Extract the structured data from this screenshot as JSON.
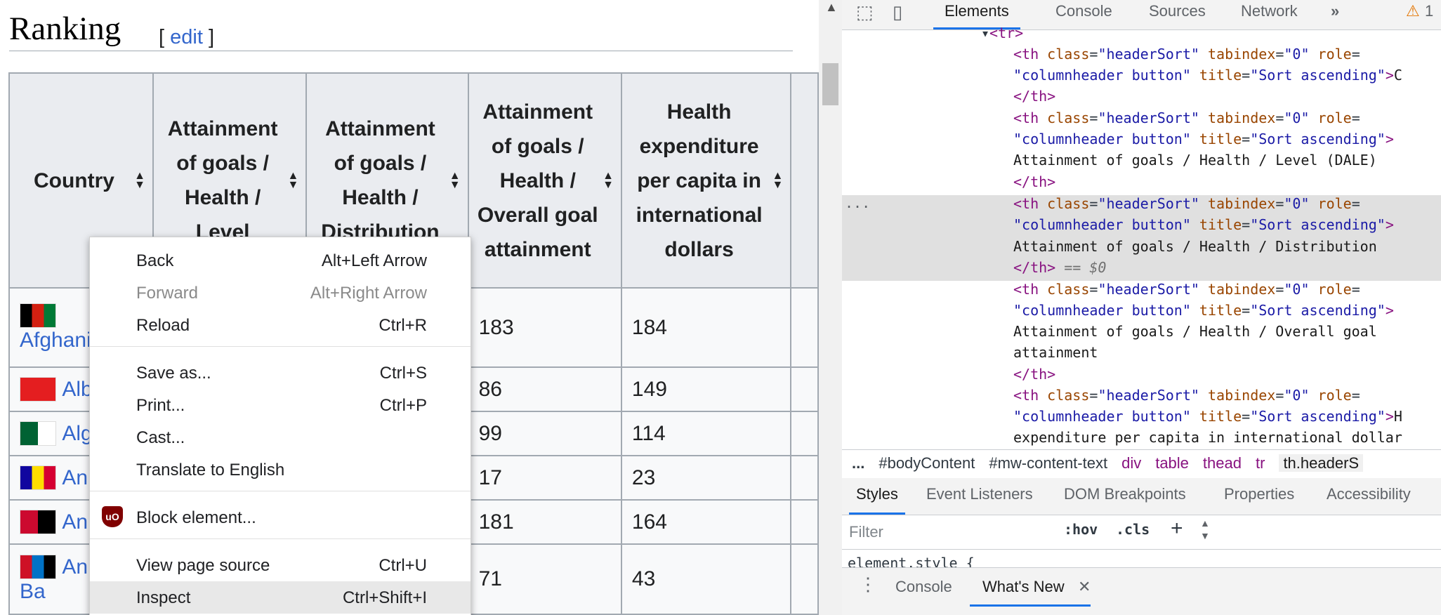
{
  "page": {
    "heading": "Ranking",
    "edit_open": "[ ",
    "edit_label": "edit",
    "edit_close": " ]"
  },
  "table": {
    "headers": [
      "Country",
      "Attainment of goals / Health / Level",
      "Attainment of goals / Health / Distribution",
      "Attainment of goals / Health / Overall goal attainment",
      "Health expenditure per capita in international dollars"
    ],
    "rows": [
      {
        "country": "Afghani",
        "level": "",
        "distribution": "",
        "overall": "183",
        "expenditure": "184",
        "flag_colors": [
          "#000000",
          "#d32011",
          "#007a36"
        ]
      },
      {
        "country": "Alb",
        "level": "",
        "distribution": "",
        "overall": "86",
        "expenditure": "149",
        "flag_colors": [
          "#e41e20"
        ]
      },
      {
        "country": "Alg",
        "level": "",
        "distribution": "",
        "overall": "99",
        "expenditure": "114",
        "flag_colors": [
          "#006233",
          "#ffffff"
        ]
      },
      {
        "country": "An",
        "level": "",
        "distribution": "",
        "overall": "17",
        "expenditure": "23",
        "flag_colors": [
          "#10069f",
          "#fedd00",
          "#d50032"
        ]
      },
      {
        "country": "An",
        "level": "",
        "distribution": "",
        "overall": "181",
        "expenditure": "164",
        "flag_colors": [
          "#cc092f",
          "#000000"
        ]
      },
      {
        "country": "An and Ba",
        "level": "",
        "distribution": "",
        "overall": "71",
        "expenditure": "43",
        "flag_colors": [
          "#ce1126",
          "#0072c6",
          "#000000"
        ]
      }
    ]
  },
  "context_menu": {
    "items": [
      {
        "label": "Back",
        "shortcut": "Alt+Left Arrow"
      },
      {
        "label": "Forward",
        "shortcut": "Alt+Right Arrow"
      },
      {
        "label": "Reload",
        "shortcut": "Ctrl+R"
      },
      {
        "label": "Save as...",
        "shortcut": "Ctrl+S"
      },
      {
        "label": "Print...",
        "shortcut": "Ctrl+P"
      },
      {
        "label": "Cast...",
        "shortcut": ""
      },
      {
        "label": "Translate to English",
        "shortcut": ""
      },
      {
        "label": "Block element...",
        "shortcut": ""
      },
      {
        "label": "View page source",
        "shortcut": "Ctrl+U"
      },
      {
        "label": "Inspect",
        "shortcut": "Ctrl+Shift+I"
      }
    ],
    "ublock_label": "uO"
  },
  "devtools": {
    "tabs": [
      "Elements",
      "Console",
      "Sources",
      "Network"
    ],
    "more": "»",
    "warning_count": "1",
    "dom": {
      "tr_open": "<tr>",
      "th_tag": "<th",
      "attr_class": "class",
      "val_class": "\"headerSort\"",
      "attr_tabindex": "tabindex",
      "val_tabindex": "\"0\"",
      "attr_role": "role",
      "val_role": "\"columnheader button\"",
      "attr_title": "title",
      "val_title": "\"Sort ascending\"",
      "close_bracket": ">",
      "th_close": "</th>",
      "selected_marker": "== $0",
      "dots": "...",
      "trail_c": "C",
      "trail_h": "H",
      "text1": "Attainment of goals / Health / Level (DALE)",
      "text2": "Attainment of goals / Health / Distribution",
      "text3a": "Attainment of goals / Health / Overall goal",
      "text3b": "attainment",
      "text4": "expenditure per capita in international dollar"
    },
    "breadcrumbs": [
      "...",
      "#bodyContent",
      "#mw-content-text",
      "div",
      "table",
      "thead",
      "tr",
      "th.headerS"
    ],
    "styles_tabs": [
      "Styles",
      "Event Listeners",
      "DOM Breakpoints",
      "Properties",
      "Accessibility"
    ],
    "filter_placeholder": "Filter",
    "hov": ":hov",
    "cls": ".cls",
    "element_style": "element.style {",
    "drawer_tabs": [
      "Console",
      "What's New"
    ]
  }
}
